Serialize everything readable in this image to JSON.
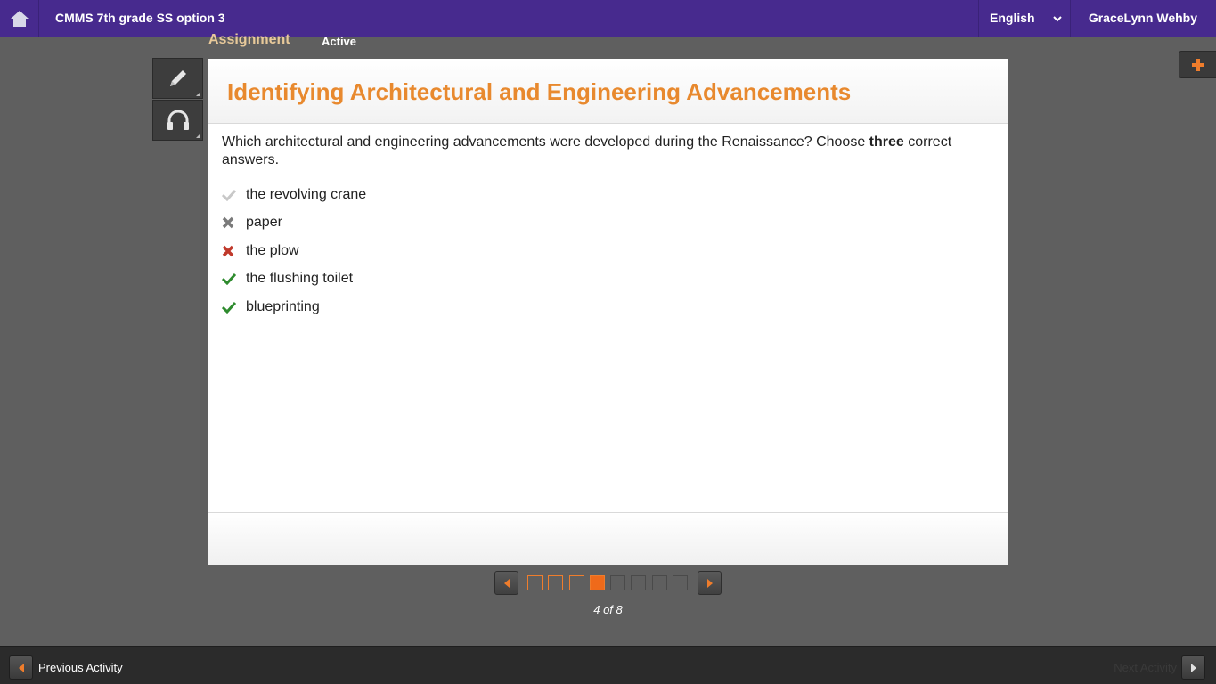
{
  "header": {
    "course_title": "CMMS 7th grade SS option 3",
    "language": "English",
    "user_name": "GraceLynn Wehby"
  },
  "assignment": {
    "label": "Assignment",
    "status": "Active"
  },
  "activity": {
    "title": "Identifying Architectural and Engineering Advancements",
    "question_prefix": "Which architectural and engineering advancements were developed during the Renaissance? Choose ",
    "question_emphasis": "three",
    "question_suffix": " correct answers.",
    "answers": [
      {
        "text": "the revolving crane",
        "mark": "check-faded"
      },
      {
        "text": "paper",
        "mark": "x-gray"
      },
      {
        "text": "the plow",
        "mark": "x-red"
      },
      {
        "text": "the flushing toilet",
        "mark": "check-green"
      },
      {
        "text": "blueprinting",
        "mark": "check-green"
      }
    ]
  },
  "pager": {
    "position_text": "4 of 8",
    "current": 4,
    "total": 8
  },
  "footer": {
    "previous_label": "Previous Activity",
    "next_label": "Next Activity"
  },
  "colors": {
    "topbar": "#472a8e",
    "title_orange": "#e8892e",
    "check_green": "#2e8b2e",
    "x_red": "#c0392b"
  }
}
